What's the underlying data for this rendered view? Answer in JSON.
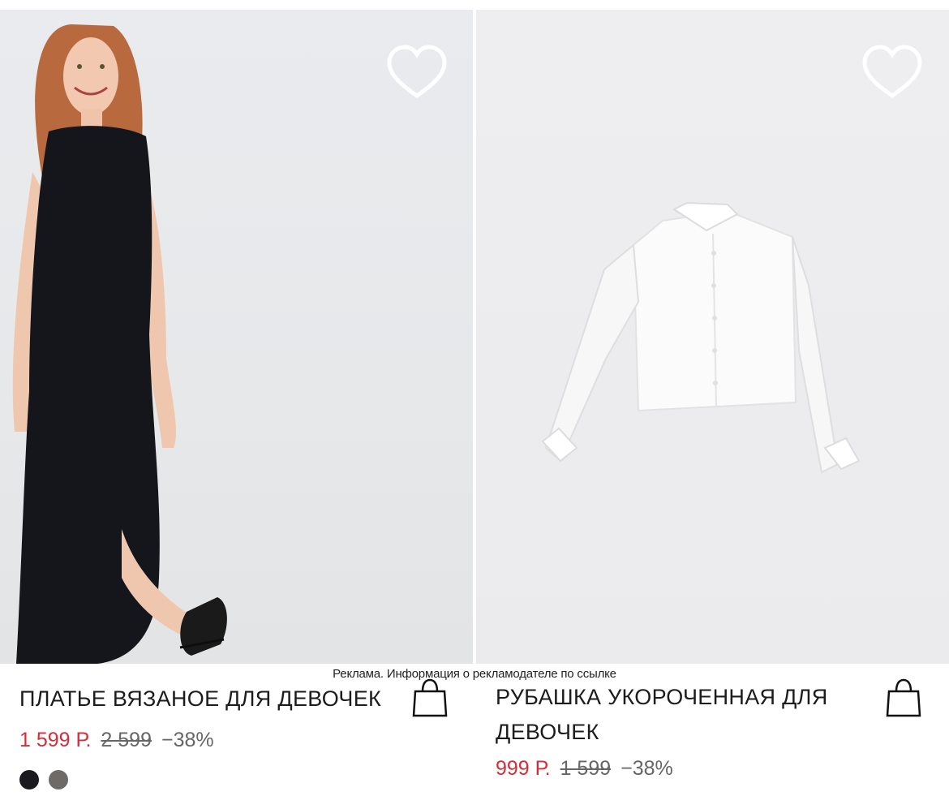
{
  "ad_notice": "Реклама. Информация о рекламодателе по ссылке",
  "products": [
    {
      "title": "ПЛАТЬЕ ВЯЗАНОЕ ДЛЯ ДЕВОЧЕК",
      "price_new": "1 599 Р.",
      "price_old": "2 599",
      "discount": "−38%",
      "colors": [
        "#1b1b1f",
        "#6e6a68"
      ],
      "favorite_icon": "heart-icon",
      "cart_icon": "shopping-bag-icon"
    },
    {
      "title": "РУБАШКА УКОРОЧЕННАЯ ДЛЯ ДЕВОЧЕК",
      "price_new": "999 Р.",
      "price_old": "1 599",
      "discount": "−38%",
      "favorite_icon": "heart-icon",
      "cart_icon": "shopping-bag-icon"
    }
  ],
  "colors": {
    "sale_price": "#d32f3a",
    "old_price": "#666666",
    "text": "#1c1c1c"
  }
}
